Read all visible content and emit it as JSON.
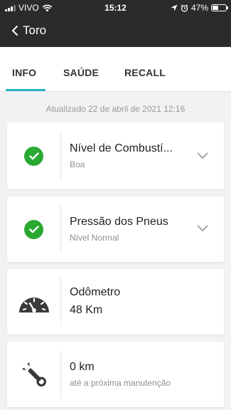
{
  "status_bar": {
    "carrier": "VIVO",
    "time": "15:12",
    "battery": "47%",
    "battery_level": 0.47
  },
  "nav": {
    "back_icon": "chevron-left-icon",
    "title": "Toro"
  },
  "tabs": [
    {
      "label": "INFO",
      "active": true
    },
    {
      "label": "SAÚDE",
      "active": false
    },
    {
      "label": "RECALL",
      "active": false
    }
  ],
  "updated_text": "Atualizado 22 de abril de 2021 12:16",
  "cards": [
    {
      "icon": "check-circle-icon",
      "title": "Nível de Combustí...",
      "subtitle": "Boa",
      "expandable": true
    },
    {
      "icon": "check-circle-icon",
      "title": "Pressão dos Pneus",
      "subtitle": "Nível Normal",
      "expandable": true
    },
    {
      "icon": "speedometer-icon",
      "title": "Odômetro",
      "value": "48 Km"
    },
    {
      "icon": "wrench-icon",
      "title": "0 km",
      "subtitle": "até a próxima manutenção"
    }
  ],
  "colors": {
    "header_bg": "#2b2b2b",
    "accent": "#2bb5c6",
    "ok_green": "#29a832",
    "icon_dark": "#3a3a3a"
  }
}
